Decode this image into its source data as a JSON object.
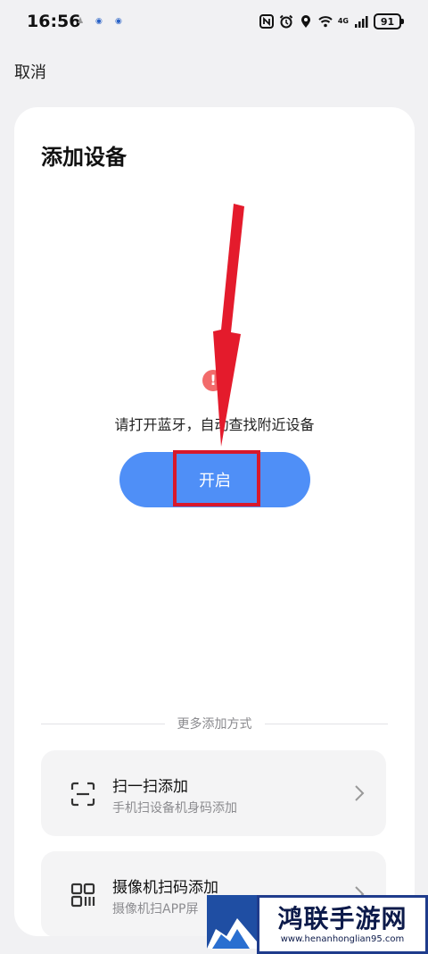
{
  "status": {
    "time": "16:56",
    "network": "4G",
    "battery": "91"
  },
  "nav": {
    "cancel_label": "取消"
  },
  "card": {
    "title": "添加设备",
    "alert_symbol": "!",
    "hint": "请打开蓝牙，自动查找附近设备",
    "open_button_label": "开启"
  },
  "more": {
    "label": "更多添加方式",
    "options": [
      {
        "title": "扫一扫添加",
        "subtitle": "手机扫设备机身码添加",
        "icon": "scan-icon"
      },
      {
        "title": "摄像机扫码添加",
        "subtitle": "摄像机扫APP屏",
        "icon": "qr-code-icon"
      }
    ]
  },
  "watermark": {
    "name": "鸿联手游网",
    "url": "www.henanhonglian95.com"
  },
  "colors": {
    "accent": "#4f8ff7",
    "annotation": "#d8182b",
    "background": "#f1f1f3",
    "card": "#ffffff"
  }
}
